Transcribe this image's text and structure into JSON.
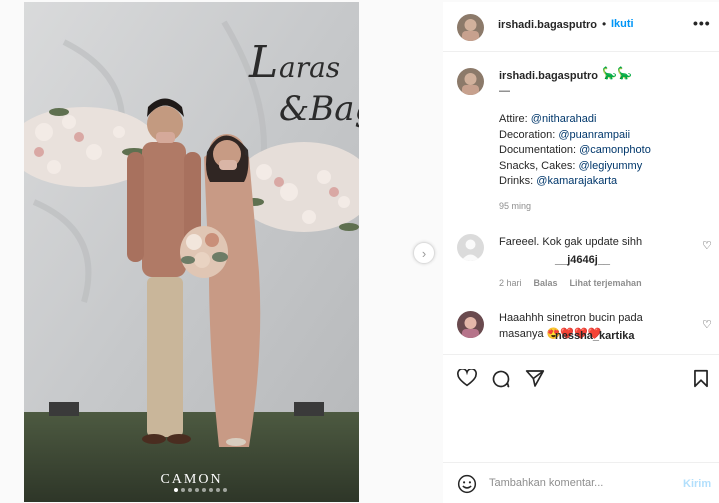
{
  "post": {
    "username": "irshadi.bagasputro",
    "follow_label": "Ikuti",
    "separator": "•",
    "more_label": "•••",
    "watermark": "CAMON",
    "photo_script_text": "Laras & Bag",
    "carousel_count": 8,
    "carousel_active": 0
  },
  "caption": {
    "username": "irshadi.bagasputro",
    "emoji": "🦕🦕",
    "dash": "—",
    "lines": [
      {
        "label": "Attire: ",
        "mention": "@nitharahadi"
      },
      {
        "label": "Decoration: ",
        "mention": "@puanrampaii"
      },
      {
        "label": "Documentation: ",
        "mention": "@camonphoto"
      },
      {
        "label": "Snacks, Cakes: ",
        "mention": "@legiyummy"
      },
      {
        "label": "Drinks: ",
        "mention": "@kamarajakarta"
      }
    ],
    "time": "95 ming"
  },
  "comments": [
    {
      "username": "__j4646j__",
      "text": " Fareeel. Kok gak update sihh",
      "time": "2 hari",
      "reply_label": "Balas",
      "translate_label": "Lihat terjemahan"
    },
    {
      "username": "nessha_kartika",
      "text": " Haaahhh sinetron bucin pada masanya 😍❤️❤️❤️"
    }
  ],
  "add_comment": {
    "placeholder": "Tambahkan komentar...",
    "post_label": "Kirim"
  },
  "colors": {
    "link": "#0095f6",
    "mention": "#00376b",
    "muted": "#8e8e8e",
    "post_disabled": "#b2dffc"
  },
  "icons": {
    "like": "heart-icon",
    "comment": "comment-icon",
    "share": "send-icon",
    "save": "bookmark-icon",
    "emoji": "smile-icon",
    "next": "chevron-right-icon"
  }
}
